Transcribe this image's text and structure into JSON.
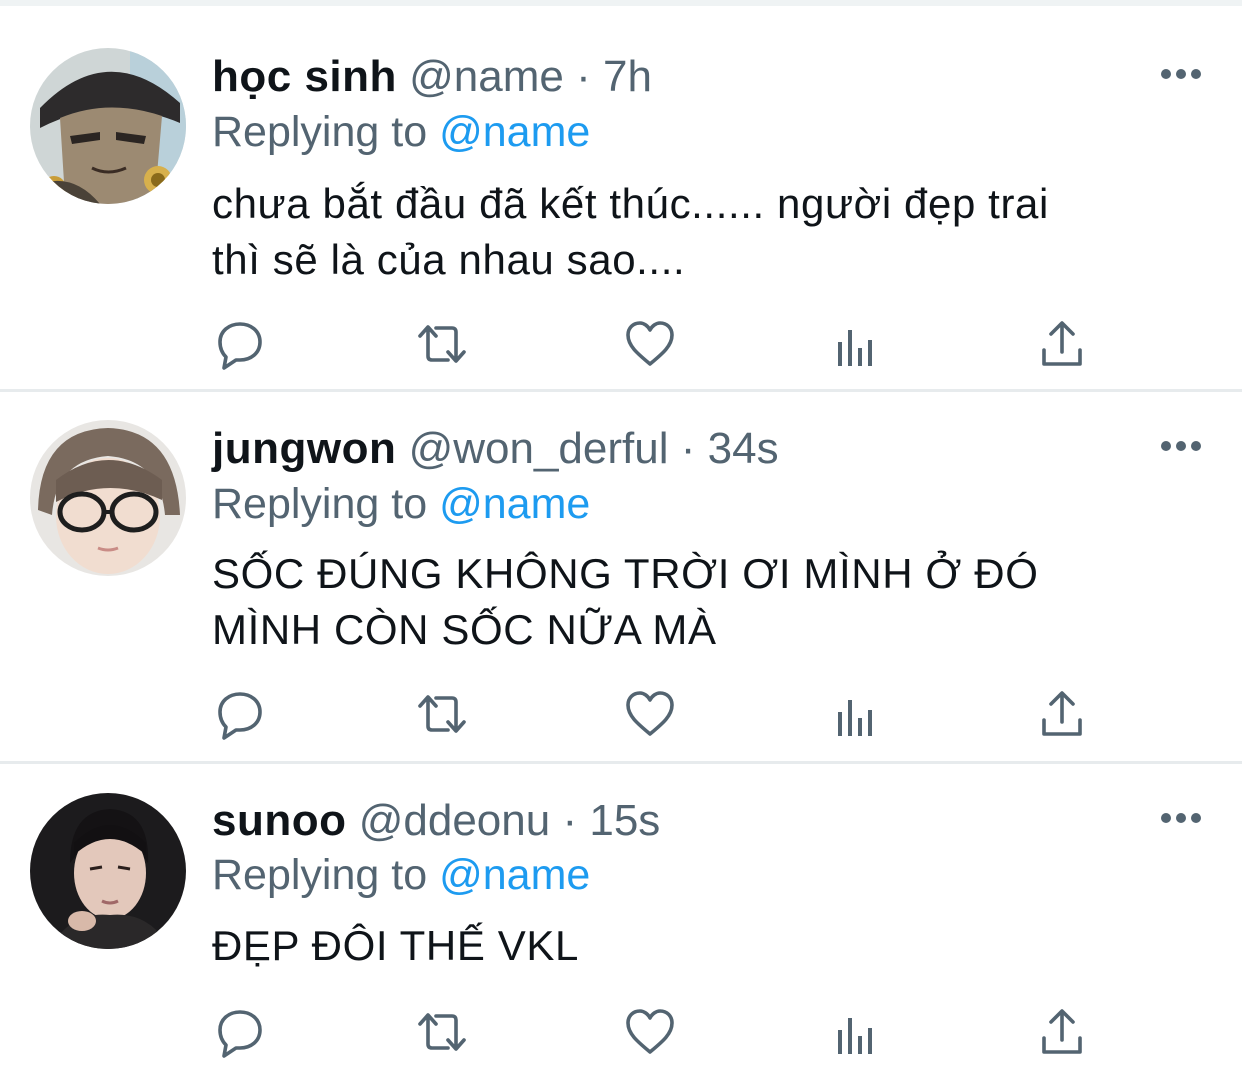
{
  "tweets": [
    {
      "display_name": "học sinh",
      "handle": "@name",
      "separator": "·",
      "time": "7h",
      "replying_prefix": "Replying to",
      "replying_to": "@name",
      "text_lines": [
        "chưa bắt đầu đã kết thúc...... người đẹp trai",
        "thì sẽ là của nhau sao...."
      ],
      "avatar_icon": "anime-character-avatar"
    },
    {
      "display_name": "jungwon",
      "handle": "@won_derful",
      "separator": "·",
      "time": "34s",
      "replying_prefix": "Replying to",
      "replying_to": "@name",
      "text_lines": [
        "SỐC ĐÚNG KHÔNG TRỜI ƠI MÌNH Ở ĐÓ",
        "MÌNH CÒN SỐC NỮA MÀ"
      ],
      "avatar_icon": "person-with-glasses-avatar"
    },
    {
      "display_name": "sunoo",
      "handle": "@ddeonu",
      "separator": "·",
      "time": "15s",
      "replying_prefix": "Replying to",
      "replying_to": "@name",
      "text_lines": [
        "ĐẸP ĐÔI THẾ VKL"
      ],
      "avatar_icon": "person-portrait-avatar"
    }
  ],
  "icons": {
    "more": "more-dots-icon",
    "reply": "reply-bubble-icon",
    "retweet": "retweet-icon",
    "like": "heart-icon",
    "stats": "analytics-bars-icon",
    "share": "share-upload-icon"
  },
  "colors": {
    "primary_text": "#0f1419",
    "secondary_text": "#536471",
    "link": "#1d9bf0",
    "divider": "#e7ebed"
  }
}
